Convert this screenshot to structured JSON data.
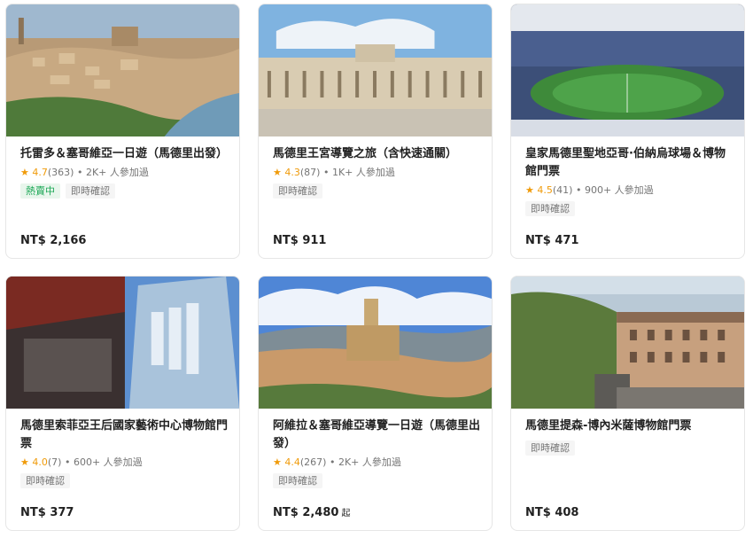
{
  "cards": [
    {
      "title": "托雷多＆塞哥維亞一日遊（馬德里出發）",
      "star": "★",
      "score": "4.7",
      "reviews": "(363)",
      "participants": "2K+ 人參加過",
      "tags": [
        "熱賣中",
        "即時確認"
      ],
      "price": "NT$ 2,166",
      "price_suffix": ""
    },
    {
      "title": "馬德里王宮導覽之旅（含快速通關）",
      "star": "★",
      "score": "4.3",
      "reviews": "(87)",
      "participants": "1K+ 人參加過",
      "tags": [
        "即時確認"
      ],
      "price": "NT$ 911",
      "price_suffix": ""
    },
    {
      "title": "皇家馬德里聖地亞哥·伯納烏球場＆博物館門票",
      "star": "★",
      "score": "4.5",
      "reviews": "(41)",
      "participants": "900+ 人參加過",
      "tags": [
        "即時確認"
      ],
      "price": "NT$ 471",
      "price_suffix": ""
    },
    {
      "title": "馬德里索菲亞王后國家藝術中心博物館門票",
      "star": "★",
      "score": "4.0",
      "reviews": "(7)",
      "participants": "600+ 人參加過",
      "tags": [
        "即時確認"
      ],
      "price": "NT$ 377",
      "price_suffix": ""
    },
    {
      "title": "阿維拉＆塞哥維亞導覽一日遊（馬德里出發）",
      "star": "★",
      "score": "4.4",
      "reviews": "(267)",
      "participants": "2K+ 人參加過",
      "tags": [
        "即時確認"
      ],
      "price": "NT$ 2,480",
      "price_suffix": "起"
    },
    {
      "title": "馬德里提森-博內米薩博物館門票",
      "star": "",
      "score": "",
      "reviews": "",
      "participants": "",
      "tags": [
        "即時確認"
      ],
      "price": "NT$ 408",
      "price_suffix": ""
    }
  ],
  "colors": {
    "star": "#f09b0a",
    "hot_text": "#1aa755",
    "hot_bg": "#e8f6ec",
    "tag_bg": "#f5f5f5"
  }
}
